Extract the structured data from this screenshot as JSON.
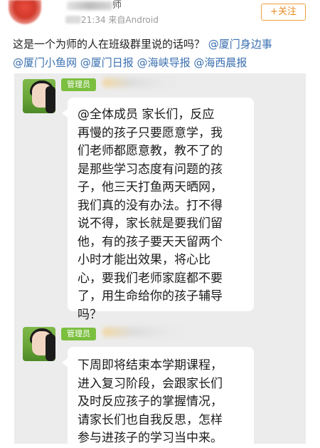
{
  "header": {
    "author_suffix": "师",
    "time": "21:34",
    "source": "来自Android",
    "follow_label": "+关注"
  },
  "post": {
    "lead": "这是一个为师的人在班级群里说的话吗？",
    "mentions": [
      "@厦门身边事",
      "@厦门小鱼网",
      "@厦门日报",
      "@海峡导报",
      "@海西晨报"
    ]
  },
  "chat": {
    "messages": [
      {
        "badge": "管理员",
        "lines": [
          "@全体成员 家长们，反应",
          "再慢的孩子只要愿意学，我",
          "们老师都愿意教，教不了的",
          "是那些学习态度有问题的孩",
          "子，他三天打鱼两天晒网，",
          "我们真的没有办法。打不得",
          "说不得，家长就是要我们留",
          "他，有的孩子要天天留两个",
          "小时才能出效果，将心比",
          "心，要我们老师家庭都不要",
          "了，用生命给你的孩子辅导",
          "吗？"
        ]
      },
      {
        "badge": "管理员",
        "lines": [
          "下周即将结束本学期课程，",
          "进入复习阶段，会跟家长们",
          "及时反应孩子的掌握情况，",
          "请家长们也自我反思，怎样",
          "参与进孩子的学习当中来。"
        ]
      }
    ]
  }
}
